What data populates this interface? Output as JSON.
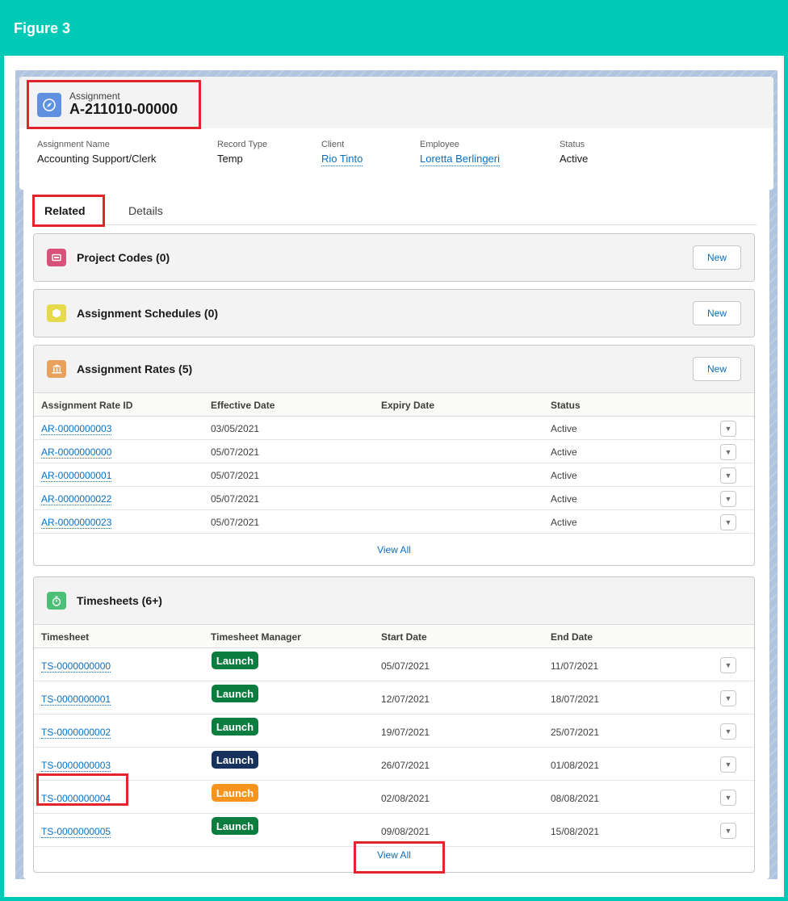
{
  "figure_label": "Figure 3",
  "record": {
    "object_label": "Assignment",
    "name": "A-211010-00000",
    "fields": [
      {
        "label": "Assignment Name",
        "value": "Accounting Support/Clerk",
        "link": false
      },
      {
        "label": "Record Type",
        "value": "Temp",
        "link": false
      },
      {
        "label": "Client",
        "value": "Rio Tinto",
        "link": true
      },
      {
        "label": "Employee",
        "value": "Loretta Berlingeri",
        "link": true
      },
      {
        "label": "Status",
        "value": "Active",
        "link": false
      }
    ]
  },
  "tabs": {
    "related": "Related",
    "details": "Details"
  },
  "project_codes": {
    "title": "Project Codes (0)",
    "new_label": "New"
  },
  "schedules": {
    "title": "Assignment Schedules (0)",
    "new_label": "New"
  },
  "rates": {
    "title": "Assignment Rates (5)",
    "new_label": "New",
    "columns": [
      "Assignment Rate ID",
      "Effective Date",
      "Expiry Date",
      "Status"
    ],
    "rows": [
      {
        "id": "AR-0000000003",
        "effective": "03/05/2021",
        "expiry": "",
        "status": "Active"
      },
      {
        "id": "AR-0000000000",
        "effective": "05/07/2021",
        "expiry": "",
        "status": "Active"
      },
      {
        "id": "AR-0000000001",
        "effective": "05/07/2021",
        "expiry": "",
        "status": "Active"
      },
      {
        "id": "AR-0000000022",
        "effective": "05/07/2021",
        "expiry": "",
        "status": "Active"
      },
      {
        "id": "AR-0000000023",
        "effective": "05/07/2021",
        "expiry": "",
        "status": "Active"
      }
    ],
    "view_all": "View All"
  },
  "timesheets": {
    "title": "Timesheets (6+)",
    "columns": [
      "Timesheet",
      "Timesheet Manager",
      "Start Date",
      "End Date"
    ],
    "rows": [
      {
        "id": "TS-0000000000",
        "launch": "Launch",
        "color": "#0b7d3e",
        "start": "05/07/2021",
        "end": "11/07/2021"
      },
      {
        "id": "TS-0000000001",
        "launch": "Launch",
        "color": "#0b7d3e",
        "start": "12/07/2021",
        "end": "18/07/2021"
      },
      {
        "id": "TS-0000000002",
        "launch": "Launch",
        "color": "#0b7d3e",
        "start": "19/07/2021",
        "end": "25/07/2021"
      },
      {
        "id": "TS-0000000003",
        "launch": "Launch",
        "color": "#16325c",
        "start": "26/07/2021",
        "end": "01/08/2021"
      },
      {
        "id": "TS-0000000004",
        "launch": "Launch",
        "color": "#f7941d",
        "start": "02/08/2021",
        "end": "08/08/2021"
      },
      {
        "id": "TS-0000000005",
        "launch": "Launch",
        "color": "#0b7d3e",
        "start": "09/08/2021",
        "end": "15/08/2021"
      }
    ],
    "view_all": "View All"
  },
  "icons": {
    "record": "compass-icon",
    "project_codes": "project-code-icon",
    "schedules": "schedule-hexagon-icon",
    "rates": "bank-icon",
    "timesheets": "stopwatch-icon",
    "row_menu": "chevron-down-icon"
  },
  "colors": {
    "frame": "#00c9b5",
    "highlight": "#e3242b",
    "link": "#0b6fc1",
    "project_codes_icon": "#d9507a",
    "schedules_icon": "#e6d94a",
    "rates_icon": "#e8a25d",
    "timesheets_icon": "#4bc076"
  }
}
